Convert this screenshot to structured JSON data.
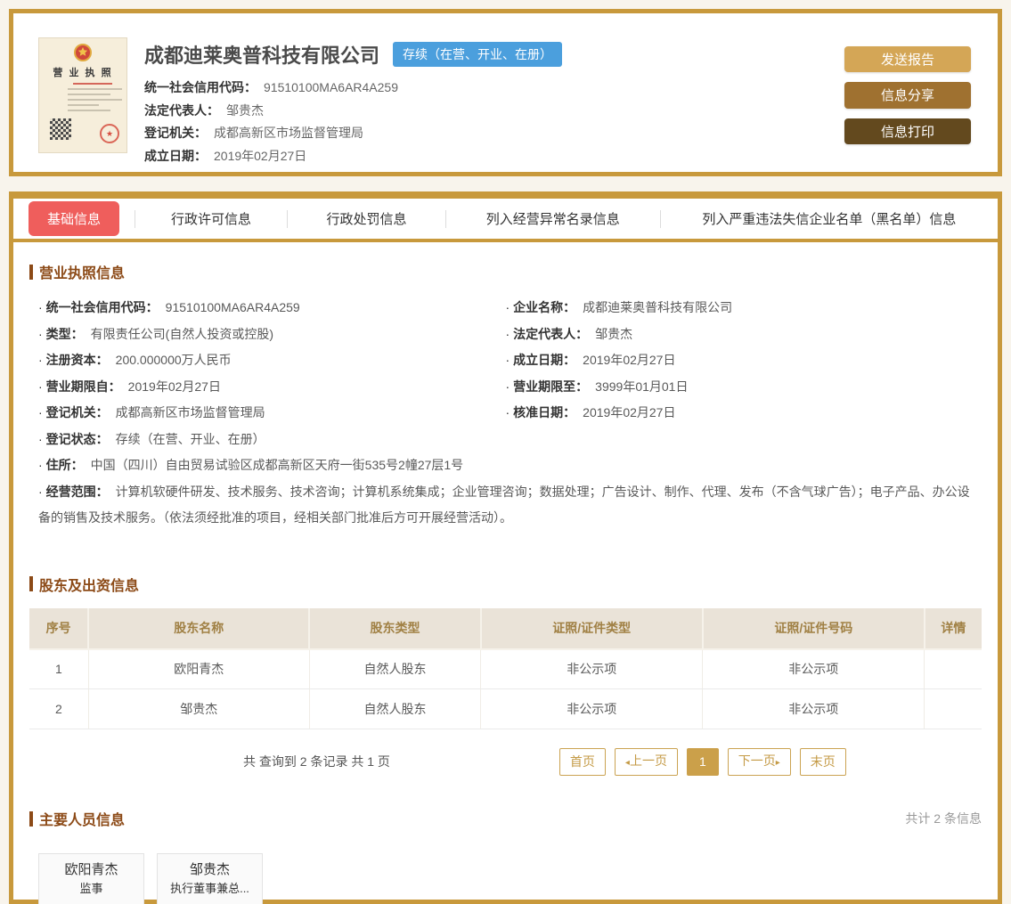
{
  "colors": {
    "frame_gold": "#c8993c",
    "active_tab_red": "#ef5e5c",
    "status_badge_blue": "#4b9fdd",
    "section_brown": "#8c4a17",
    "table_header_bg": "#eae3d8",
    "table_header_text": "#a08044",
    "btn_send": "#d4a656",
    "btn_share": "#9f7130",
    "btn_print": "#63491e",
    "pagination_gold": "#cba352"
  },
  "glyphs": {
    "bullet": "·",
    "prev_arrow": "◂",
    "next_arrow": "▸",
    "seal_star": "★"
  },
  "header": {
    "company_name": "成都迪莱奥普科技有限公司",
    "status_badge": "存续（在营、开业、在册）",
    "license_image_title": "营 业 执 照",
    "fields": [
      {
        "label": "统一社会信用代码：",
        "value": "91510100MA6AR4A259"
      },
      {
        "label": "法定代表人：",
        "value": "邹贵杰"
      },
      {
        "label": "登记机关：",
        "value": "成都高新区市场监督管理局"
      },
      {
        "label": "成立日期：",
        "value": "2019年02月27日"
      }
    ],
    "buttons": {
      "send_report": "发送报告",
      "share": "信息分享",
      "print": "信息打印"
    }
  },
  "tabs": {
    "items": [
      {
        "label": "基础信息"
      },
      {
        "label": "行政许可信息"
      },
      {
        "label": "行政处罚信息"
      },
      {
        "label": "列入经营异常名录信息"
      },
      {
        "label": "列入严重违法失信企业名单（黑名单）信息"
      }
    ],
    "active_index": 0
  },
  "business_license": {
    "title": "营业执照信息",
    "left": [
      {
        "label": "统一社会信用代码：",
        "value": "91510100MA6AR4A259"
      },
      {
        "label": "类型：",
        "value": "有限责任公司(自然人投资或控股)"
      },
      {
        "label": "注册资本：",
        "value": "200.000000万人民币"
      },
      {
        "label": "营业期限自：",
        "value": "2019年02月27日"
      },
      {
        "label": "登记机关：",
        "value": "成都高新区市场监督管理局"
      },
      {
        "label": "登记状态：",
        "value": "存续（在营、开业、在册）"
      }
    ],
    "right": [
      {
        "label": "企业名称：",
        "value": "成都迪莱奥普科技有限公司"
      },
      {
        "label": "法定代表人：",
        "value": "邹贵杰"
      },
      {
        "label": "成立日期：",
        "value": "2019年02月27日"
      },
      {
        "label": "营业期限至：",
        "value": "3999年01月01日"
      },
      {
        "label": "核准日期：",
        "value": "2019年02月27日"
      }
    ],
    "address": {
      "label": "住所：",
      "value": "中国（四川）自由贸易试验区成都高新区天府一街535号2幢27层1号"
    },
    "scope": {
      "label": "经营范围：",
      "value": "计算机软硬件研发、技术服务、技术咨询；计算机系统集成；企业管理咨询；数据处理；广告设计、制作、代理、发布（不含气球广告）；电子产品、办公设备的销售及技术服务。（依法须经批准的项目，经相关部门批准后方可开展经营活动）。"
    }
  },
  "shareholders": {
    "title": "股东及出资信息",
    "columns": [
      "序号",
      "股东名称",
      "股东类型",
      "证照/证件类型",
      "证照/证件号码",
      "详情"
    ],
    "rows": [
      [
        "1",
        "欧阳青杰",
        "自然人股东",
        "非公示项",
        "非公示项",
        ""
      ],
      [
        "2",
        "邹贵杰",
        "自然人股东",
        "非公示项",
        "非公示项",
        ""
      ]
    ],
    "record_summary": "共 查询到 2 条记录 共 1 页",
    "pagination": {
      "first": "首页",
      "prev": "上一页",
      "current": "1",
      "next": "下一页",
      "last": "末页"
    }
  },
  "personnel": {
    "title": "主要人员信息",
    "count_text": "共计 2 条信息",
    "people": [
      {
        "name": "欧阳青杰",
        "role": "监事"
      },
      {
        "name": "邹贵杰",
        "role": "执行董事兼总..."
      }
    ]
  }
}
